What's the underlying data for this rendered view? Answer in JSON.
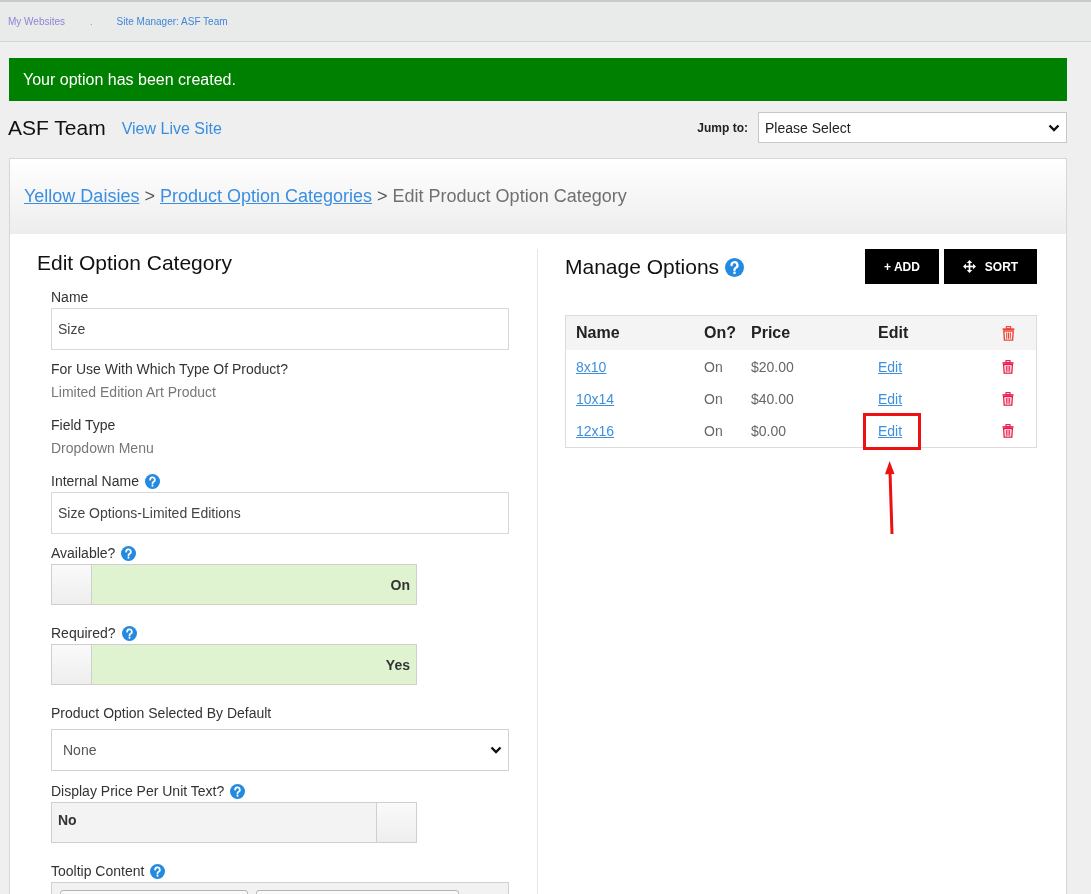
{
  "top_nav": {
    "links": [
      {
        "label": "My Websites",
        "visited": true
      },
      {
        "label": "Site Manager: ASF Team",
        "visited": false
      }
    ],
    "separator": "."
  },
  "alert": {
    "message": "Your option has been created."
  },
  "header": {
    "site_name": "ASF Team",
    "live_link": "View Live Site",
    "jump_to": {
      "label": "Jump to:",
      "value": "Please Select"
    }
  },
  "breadcrumb": {
    "links": [
      "Yellow Daisies",
      "Product Option Categories"
    ],
    "separator": ">",
    "current": "Edit Product Option Category"
  },
  "edit_panel": {
    "title": "Edit Option Category",
    "fields": [
      {
        "kind": "input",
        "label": "Name",
        "help": false,
        "value": "Size"
      },
      {
        "kind": "static",
        "label": "For Use With Which Type Of Product?",
        "help": false,
        "value": "Limited Edition Art Product"
      },
      {
        "kind": "static",
        "label": "Field Type",
        "help": false,
        "value": "Dropdown Menu"
      },
      {
        "kind": "input",
        "label": "Internal Name",
        "help": true,
        "value": "Size Options-Limited Editions"
      },
      {
        "kind": "toggle",
        "label": "Available?",
        "help": true,
        "on": true,
        "value": "On"
      },
      {
        "kind": "toggle",
        "label": "Required?",
        "help": true,
        "on": true,
        "value": "Yes"
      },
      {
        "kind": "select",
        "label": "Product Option Selected By Default",
        "help": false,
        "value": "None"
      },
      {
        "kind": "toggle",
        "label": "Display Price Per Unit Text?",
        "help": true,
        "on": false,
        "value": "No"
      },
      {
        "kind": "editor",
        "label": "Tooltip Content",
        "help": true
      }
    ]
  },
  "options_panel": {
    "title": "Manage Options",
    "help": true,
    "buttons": [
      {
        "kind": "add",
        "label": "+ ADD"
      },
      {
        "kind": "sort",
        "label": "SORT"
      }
    ],
    "table": {
      "columns": [
        "Name",
        "On?",
        "Price",
        "Edit"
      ],
      "rows": [
        {
          "name": "8x10",
          "status": "On",
          "price": "$20.00",
          "edit": "Edit",
          "highlighted": false
        },
        {
          "name": "10x14",
          "status": "On",
          "price": "$40.00",
          "edit": "Edit",
          "highlighted": false
        },
        {
          "name": "12x16",
          "status": "On",
          "price": "$0.00",
          "edit": "Edit",
          "highlighted": true
        }
      ]
    }
  }
}
